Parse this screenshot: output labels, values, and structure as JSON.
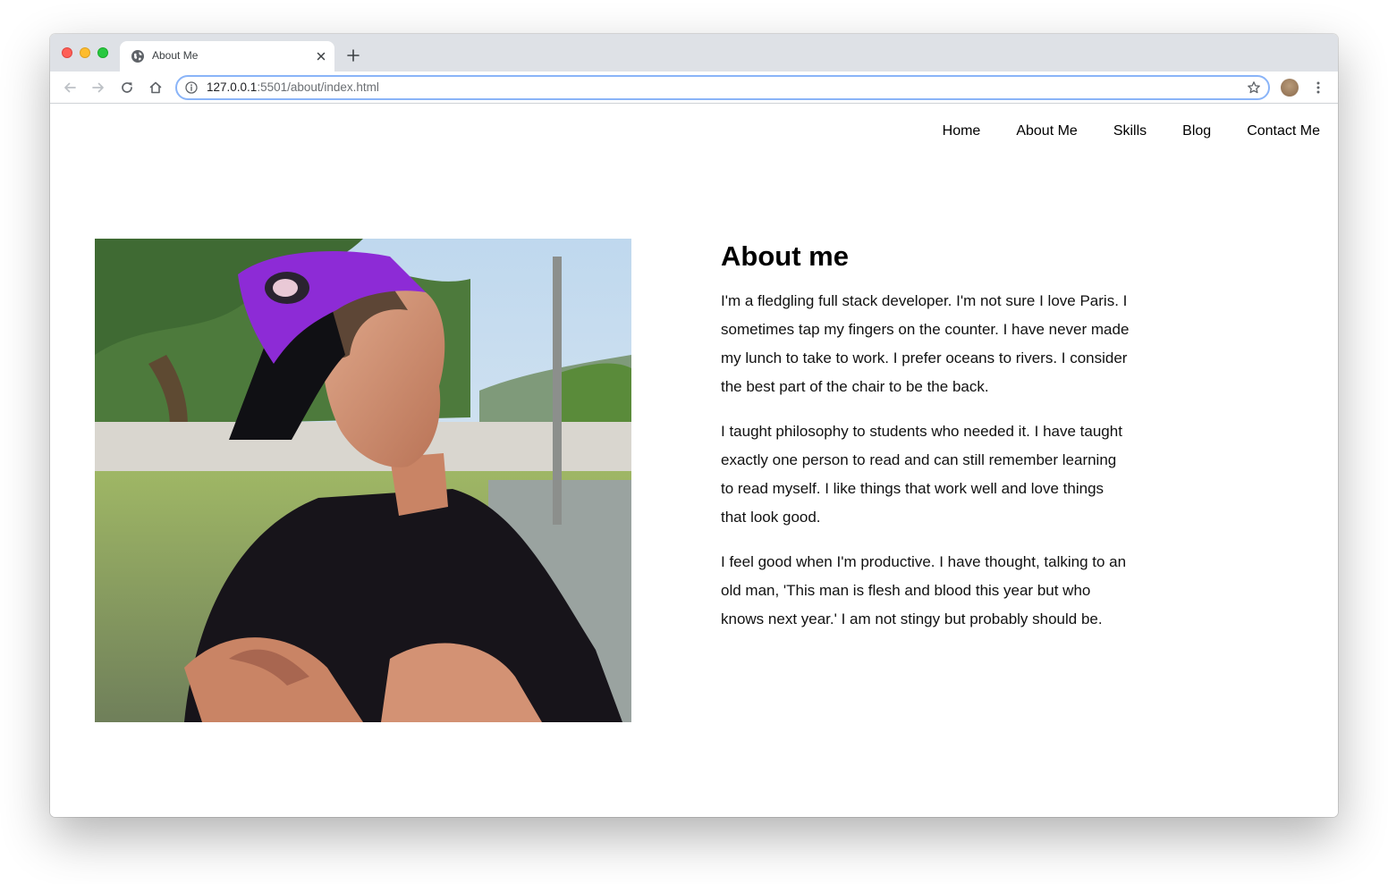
{
  "browser": {
    "tab_title": "About Me",
    "url_host": "127.0.0.1",
    "url_path": ":5501/about/index.html"
  },
  "nav": {
    "items": [
      "Home",
      "About Me",
      "Skills",
      "Blog",
      "Contact Me"
    ]
  },
  "about": {
    "heading": "About me",
    "paragraphs": [
      "I'm a fledgling full stack developer. I'm not sure I love Paris. I sometimes tap my fingers on the counter. I have never made my lunch to take to work. I prefer oceans to rivers. I consider the best part of the chair to be the back.",
      "I taught philosophy to students who needed it. I have taught exactly one person to read and can still remember learning to read myself. I like things that work well and love things that look good.",
      "I feel good when I'm productive. I have thought, talking to an old man, 'This man is flesh and blood this year but who knows next year.' I am not stingy but probably should be."
    ]
  },
  "colors": {
    "tabstrip": "#dee1e6",
    "omnibox_border": "#8ab4f8",
    "cap_purple": "#8d2bd6"
  },
  "icons": {
    "favicon": "globe-icon",
    "tab_close": "close-icon",
    "new_tab": "plus-icon",
    "back": "arrow-left-icon",
    "forward": "arrow-right-icon",
    "reload": "reload-icon",
    "home": "home-icon",
    "site_info": "info-icon",
    "bookmark": "star-icon",
    "menu": "kebab-menu-icon"
  }
}
